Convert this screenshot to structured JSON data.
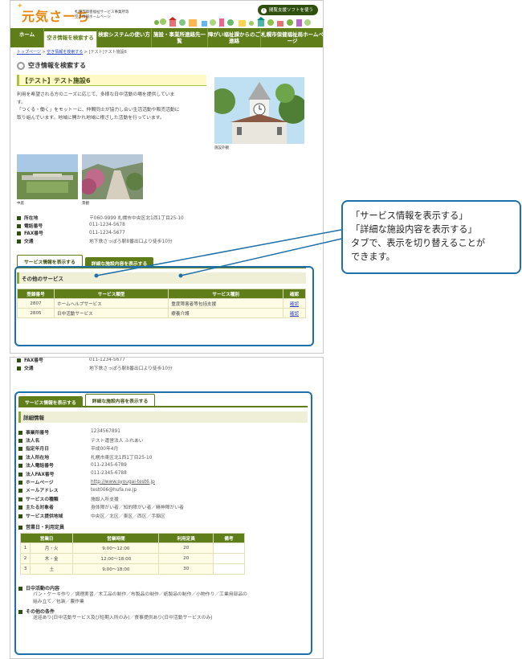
{
  "header": {
    "logo": "元気さーち",
    "org_line1": "札幌市障害福祉サービス事業所等",
    "org_line2": "空き情報ホームページ",
    "assist_label": "閲覧支援ソフトを使う"
  },
  "nav": {
    "items": [
      "ホーム",
      "空き情報を検索する",
      "検索システムの使い方",
      "施設・事業所連絡先一覧",
      "障がい福祉課からのご連絡",
      "札幌市保健福祉局ホームページ"
    ]
  },
  "breadcrumb": {
    "home": "トップページ",
    "sep": ">",
    "search": "空き情報を検索する",
    "current": "[テスト]テスト施設6"
  },
  "page_title": "空き情報を検索する",
  "facility": {
    "name": "【テスト】テスト施設6",
    "intro_1": "利用を希望される方のニーズに応じて、多様な日中活動の場を提供していま",
    "intro_2": "す。",
    "intro_3": "「つくる・働く」をモットーに、仲間同士が協力し合い生活活動や販売活動に",
    "intro_4": "取り組んでいます。地域に開かれ地域に根ざした活動を行っています。",
    "photo_caption_main": "施設外観",
    "photo_caption_1": "中庭",
    "photo_caption_2": "景観"
  },
  "info": {
    "address_label": "所在地",
    "address_value": "〒060-9999 札幌市中央区北1西1丁目25-10",
    "tel_label": "電話番号",
    "tel_value": "011-1234-5678",
    "fax_label": "FAX番号",
    "fax_value": "011-1234-5677",
    "access_label": "交通",
    "access_value": "地下鉄さっぽろ駅8番出口より徒歩10分"
  },
  "tabs": {
    "service": "サービス情報を表示する",
    "detail": "詳細な施設内容を表示する"
  },
  "service_table": {
    "section": "その他のサービス",
    "headers": [
      "登録番号",
      "サービス類型",
      "サービス種別",
      "確認"
    ],
    "rows": [
      [
        "2807",
        "ホームヘルプサービス",
        "重度障害者等包括支援",
        "確認"
      ],
      [
        "2805",
        "日中活動サービス",
        "療養介護",
        "確認"
      ]
    ]
  },
  "callout": {
    "line1": "「サービス情報を表示する」",
    "line2": "「詳細な施設内容を表示する」",
    "line3": "タブで、表示を切り替えることが",
    "line4": "できます。"
  },
  "details": {
    "section": "詳細情報",
    "items": [
      [
        "事業所番号",
        "1234567891"
      ],
      [
        "法人名",
        "テスト運営法人 ふれあい"
      ],
      [
        "指定年月日",
        "平成00年4月"
      ],
      [
        "法人所在地",
        "札幌市東区北1西1丁目25-10"
      ],
      [
        "法人電話番号",
        "011-2345-6789"
      ],
      [
        "法人FAX番号",
        "011-2345-6788"
      ],
      [
        "ホームページ",
        "http://www.syougai-test6.jp"
      ],
      [
        "メールアドレス",
        "test006@hufa.ne.jp"
      ],
      [
        "サービスの種類",
        "施設入所支援"
      ],
      [
        "主たる対象者",
        "身体障がい者／知的障がい者／精神障がい者"
      ],
      [
        "サービス提供地域",
        "中央区／北区／東区／西区／手稲区"
      ]
    ],
    "hours_label": "営業日・利用定員",
    "hours_headers": [
      "営業日",
      "営業時間",
      "利用定員",
      "備考"
    ],
    "hours_rows": [
      [
        "1",
        "月・火",
        "9:00〜12:00",
        "20",
        ""
      ],
      [
        "2",
        "木・金",
        "12:00〜18:00",
        "20",
        ""
      ],
      [
        "3",
        "土",
        "9:00〜18:00",
        "30",
        ""
      ]
    ],
    "activity_label": "日中活動の内容",
    "activity_1": "パン・ケーキ作り／調理実習／木工品の制作／布製品の制作／紙製品の制作／小物作り／工業用部品の",
    "activity_2": "組み立て／包装／農作業",
    "other_label": "その他の条件",
    "other_value": "送迎あり(日中活動サービス及び短期入所のみ)／食事提供あり(日中活動サービスのみ)"
  }
}
